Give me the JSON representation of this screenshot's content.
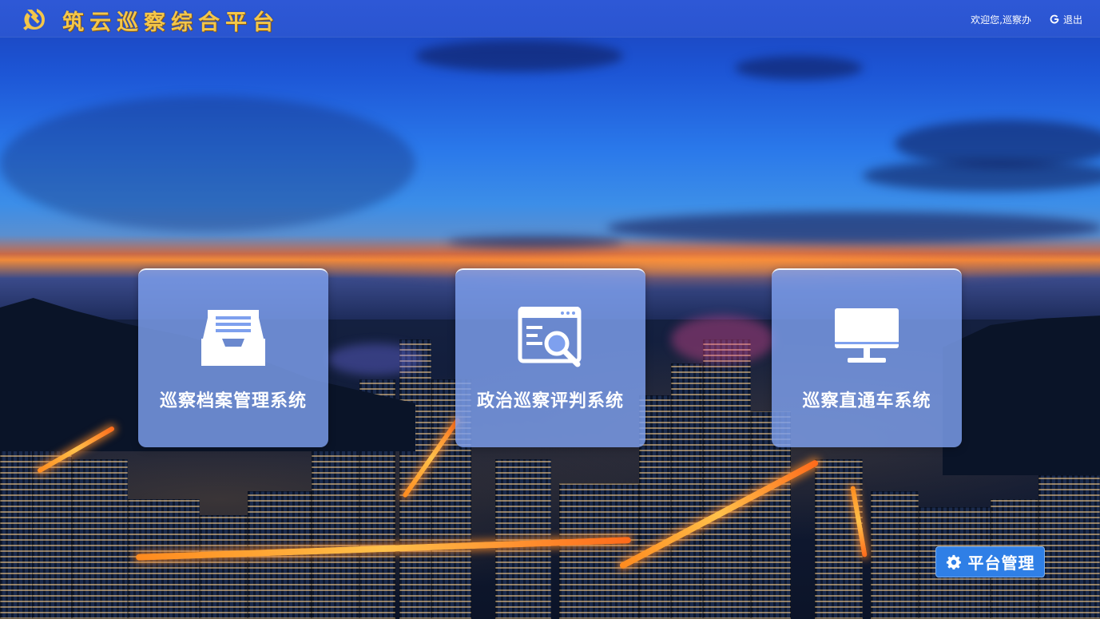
{
  "header": {
    "title": "筑云巡察综合平台",
    "welcome": "欢迎您,巡察办",
    "logout_label": "退出",
    "logo_icon": "party-emblem-icon",
    "title_color": "#f3c64a",
    "bar_color": "#2e58d6"
  },
  "cards": [
    {
      "label": "巡察档案管理系统",
      "icon": "inbox-tray-icon"
    },
    {
      "label": "政治巡察评判系统",
      "icon": "browser-search-icon"
    },
    {
      "label": "巡察直通车系统",
      "icon": "monitor-icon"
    }
  ],
  "platform_management": {
    "label": "平台管理",
    "icon": "gear-icon",
    "color": "#2f7fe6"
  }
}
